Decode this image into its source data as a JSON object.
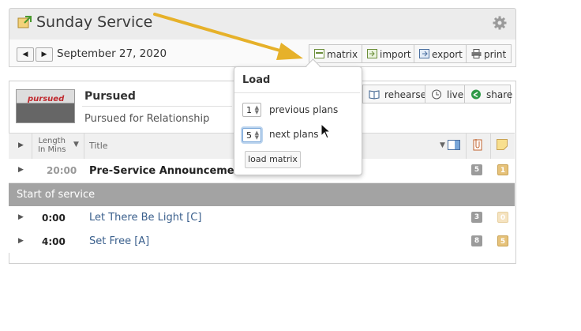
{
  "plan": {
    "title": "Sunday Service",
    "date": "September 27, 2020"
  },
  "toolbar": {
    "prev_label": "◀",
    "next_label": "▶",
    "matrix_label": "matrix",
    "import_label": "import",
    "export_label": "export",
    "print_label": "print"
  },
  "item": {
    "thumbnail_text": "pursued",
    "name": "Pursued",
    "subtitle": "Pursued for Relationship",
    "rehearse_label": "rehearse",
    "live_label": "live",
    "share_label": "share"
  },
  "table": {
    "headers": {
      "length": "Length\nIn Mins",
      "length_line1": "Length",
      "length_line2": "In Mins",
      "title": "Title"
    },
    "rows": [
      {
        "length": "20:00",
        "title": "Pre-Service Announcement Sl",
        "files": "5",
        "notes": "1"
      },
      {
        "length": "0:00",
        "title": "Let There Be Light [C]",
        "files": "3",
        "notes": "0"
      },
      {
        "length": "4:00",
        "title": "Set Free [A]",
        "files": "8",
        "notes": "5"
      }
    ],
    "section_label": "Start of service"
  },
  "popover": {
    "title": "Load",
    "previous_value": "1",
    "previous_label": "previous plans",
    "next_value": "5",
    "next_label": "next plans",
    "button_label": "load matrix"
  },
  "colors": {
    "arrow": "#e6b12a",
    "section_bg": "#a3a3a3",
    "link": "#3a5f8c"
  }
}
